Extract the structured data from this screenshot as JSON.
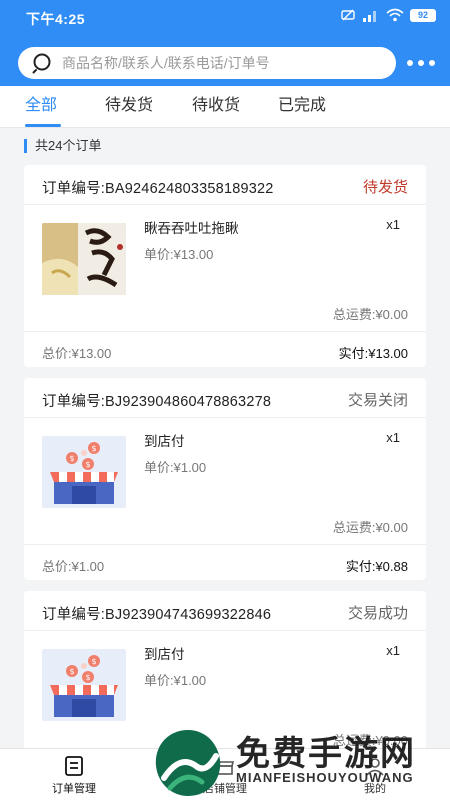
{
  "status_bar": {
    "time": "下午4:25",
    "battery": "92"
  },
  "search": {
    "placeholder": "商品名称/联系人/联系电话/订单号"
  },
  "tabs": [
    {
      "label": "全部",
      "active": true
    },
    {
      "label": "待发货",
      "active": false
    },
    {
      "label": "待收货",
      "active": false
    },
    {
      "label": "已完成",
      "active": false
    }
  ],
  "order_count": "共24个订单",
  "orders": [
    {
      "order_no": "订单编号:BA924624803358189322",
      "status": "待发货",
      "item_name": "瞅吞吞吐吐拖瞅",
      "qty": "x1",
      "unit_price": "单价:¥13.00",
      "shipping": "总运费:¥0.00",
      "total": "总价:¥13.00",
      "paid": "实付:¥13.00",
      "thumb": "snack-package-image"
    },
    {
      "order_no": "订单编号:BJ923904860478863278",
      "status": "交易关闭",
      "item_name": "到店付",
      "qty": "x1",
      "unit_price": "单价:¥1.00",
      "shipping": "总运费:¥0.00",
      "total": "总价:¥1.00",
      "paid": "实付:¥0.88",
      "thumb": "store-coins-illustration"
    },
    {
      "order_no": "订单编号:BJ923904743699322846",
      "status": "交易成功",
      "item_name": "到店付",
      "qty": "x1",
      "unit_price": "单价:¥1.00",
      "shipping": "总运费:¥0.00",
      "thumb": "store-coins-illustration"
    }
  ],
  "bottom_nav": [
    {
      "label": "订单管理",
      "icon": "order-list-icon",
      "active": true
    },
    {
      "label": "店铺管理",
      "icon": "shop-icon",
      "active": false
    },
    {
      "label": "我的",
      "icon": "user-icon",
      "active": false
    }
  ],
  "watermark": {
    "title": "免费手游网",
    "subtitle": "MIANFEISHOUYOUWANG"
  },
  "colors": {
    "brand": "#2f8df5",
    "pending": "#c0392b"
  }
}
